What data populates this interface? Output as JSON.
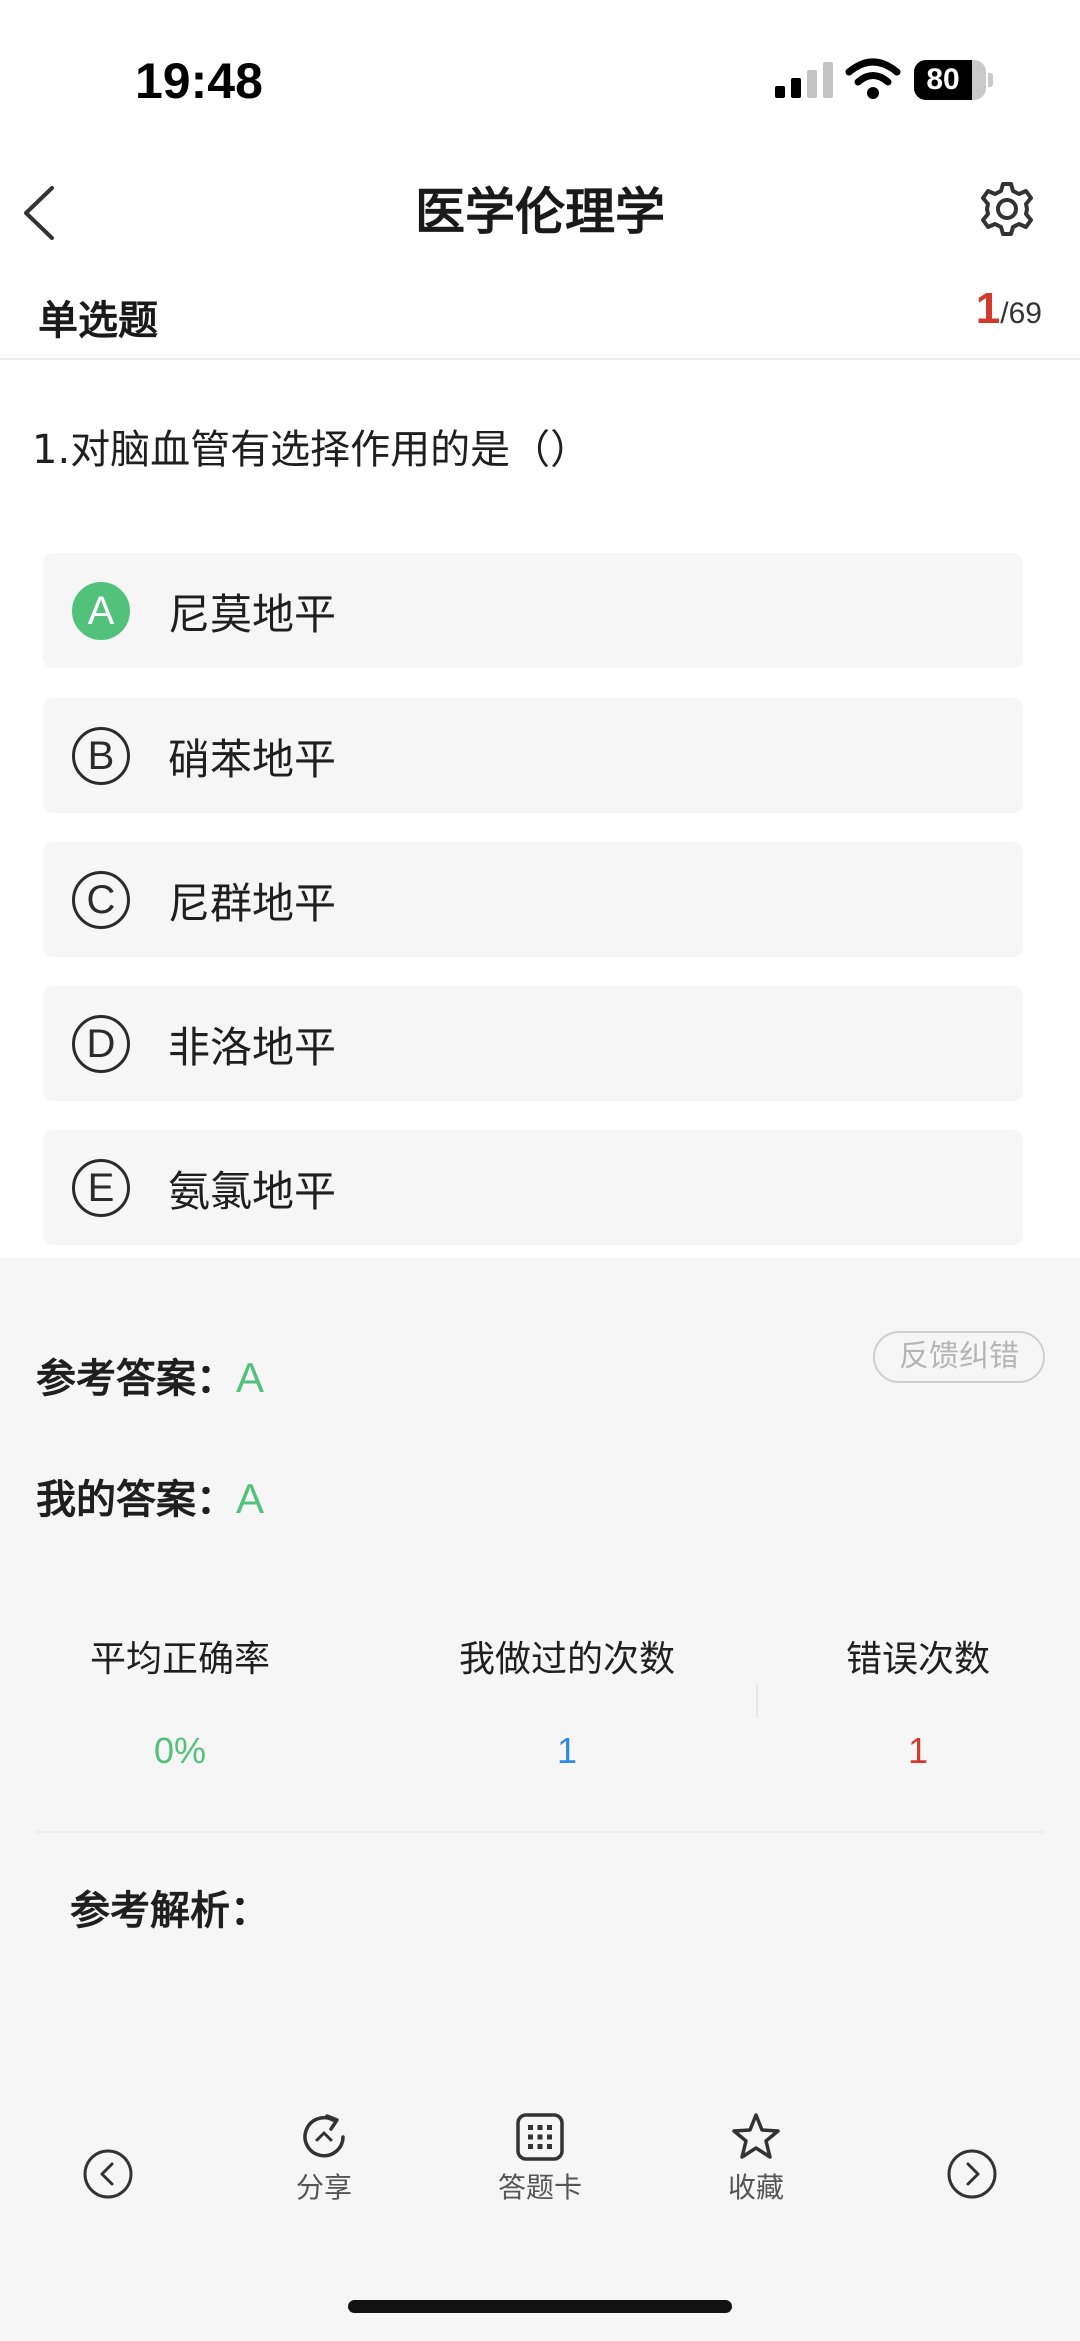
{
  "status_bar": {
    "time": "19:48",
    "battery": "80"
  },
  "nav": {
    "title": "医学伦理学",
    "back_icon": "chevron-left-icon",
    "settings_icon": "gear-icon"
  },
  "question_header": {
    "type": "单选题",
    "current": "1",
    "separator": "/",
    "total": "69"
  },
  "question": {
    "text": "1.对脑血管有选择作用的是（）",
    "selected": "A",
    "options": [
      {
        "letter": "A",
        "text": "尼莫地平"
      },
      {
        "letter": "B",
        "text": "硝苯地平"
      },
      {
        "letter": "C",
        "text": "尼群地平"
      },
      {
        "letter": "D",
        "text": "非洛地平"
      },
      {
        "letter": "E",
        "text": "氨氯地平"
      }
    ]
  },
  "answer": {
    "reference_label": "参考答案：",
    "reference_value": "A",
    "mine_label": "我的答案：",
    "mine_value": "A",
    "feedback_label": "反馈纠错"
  },
  "stats": {
    "accuracy_label": "平均正确率",
    "accuracy_value": "0%",
    "attempts_label": "我做过的次数",
    "attempts_value": "1",
    "errors_label": "错误次数",
    "errors_value": "1"
  },
  "analysis": {
    "label": "参考解析："
  },
  "toolbar": {
    "share_label": "分享",
    "card_label": "答题卡",
    "favorite_label": "收藏"
  },
  "colors": {
    "correct": "#52c27a",
    "counter_current": "#d23b2b",
    "attempts": "#2f8be0",
    "errors": "#d23b2b",
    "panel_bg": "#f6f6f6"
  }
}
